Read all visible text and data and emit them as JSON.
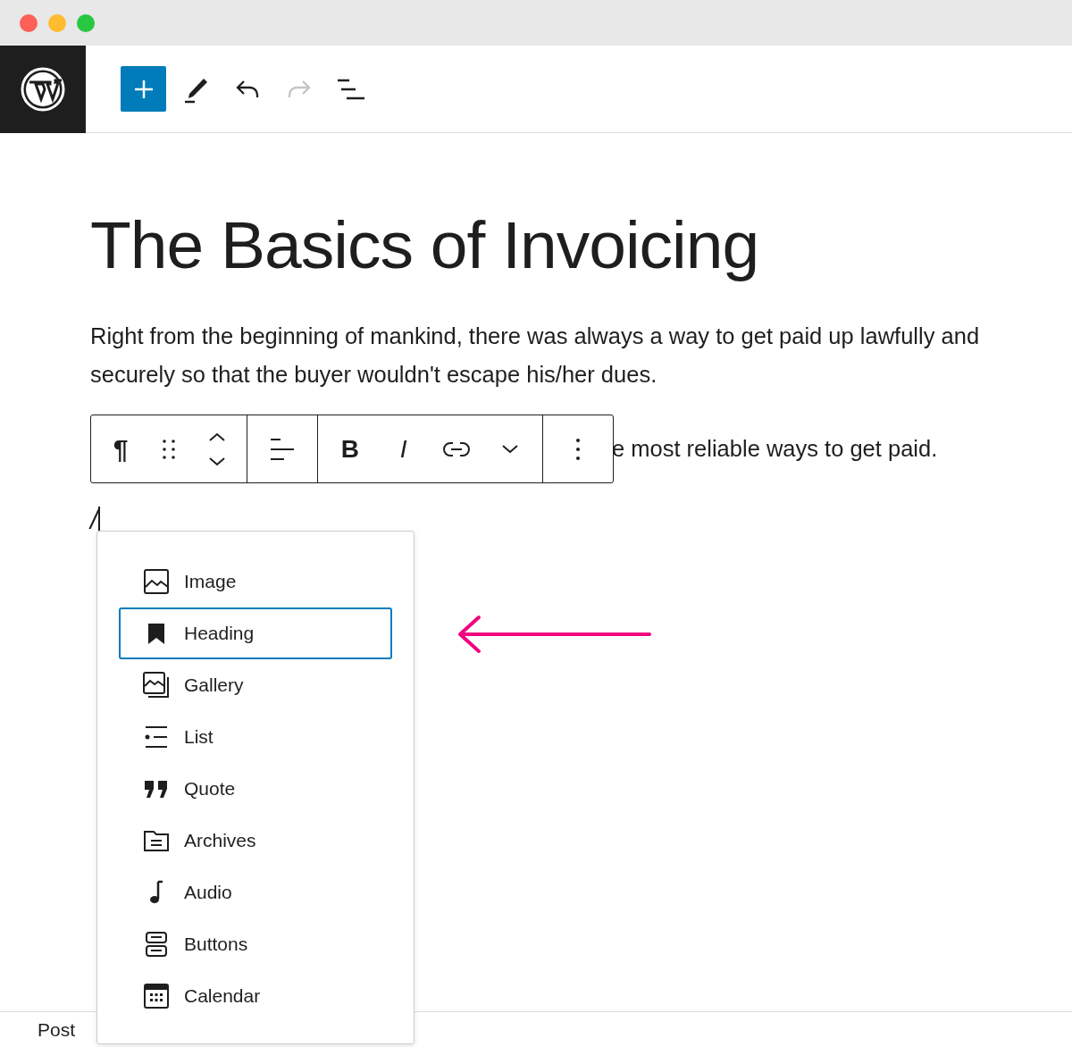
{
  "header": {
    "tools": [
      {
        "kind": "add",
        "disabled": false
      },
      {
        "kind": "edit",
        "disabled": false
      },
      {
        "kind": "undo",
        "disabled": false
      },
      {
        "kind": "redo",
        "disabled": true
      },
      {
        "kind": "outline",
        "disabled": false
      }
    ]
  },
  "post": {
    "title": "The Basics of Invoicing",
    "paragraphs": [
      "Right from the beginning of mankind, there was always a way to get paid up lawfully and securely so that the buyer wouldn't escape his/her dues.",
      "e most reliable ways to get paid."
    ],
    "block_toolbar": {
      "groups": [
        [
          {
            "kind": "paragraph",
            "label": "¶"
          },
          {
            "kind": "drag"
          },
          {
            "kind": "move"
          }
        ],
        [
          {
            "kind": "align"
          }
        ],
        [
          {
            "kind": "bold",
            "label": "B"
          },
          {
            "kind": "italic",
            "label": "I"
          },
          {
            "kind": "link"
          },
          {
            "kind": "more"
          }
        ],
        [
          {
            "kind": "options"
          }
        ]
      ]
    },
    "typed": "/"
  },
  "inserter": {
    "items": [
      {
        "label": "Image",
        "kind": "image",
        "selected": false
      },
      {
        "label": "Heading",
        "kind": "heading",
        "selected": true
      },
      {
        "label": "Gallery",
        "kind": "gallery",
        "selected": false
      },
      {
        "label": "List",
        "kind": "list",
        "selected": false
      },
      {
        "label": "Quote",
        "kind": "quote",
        "selected": false
      },
      {
        "label": "Archives",
        "kind": "archives",
        "selected": false
      },
      {
        "label": "Audio",
        "kind": "audio",
        "selected": false
      },
      {
        "label": "Buttons",
        "kind": "buttons",
        "selected": false
      },
      {
        "label": "Calendar",
        "kind": "calendar",
        "selected": false
      }
    ]
  },
  "footer": {
    "breadcrumb": "Post"
  }
}
